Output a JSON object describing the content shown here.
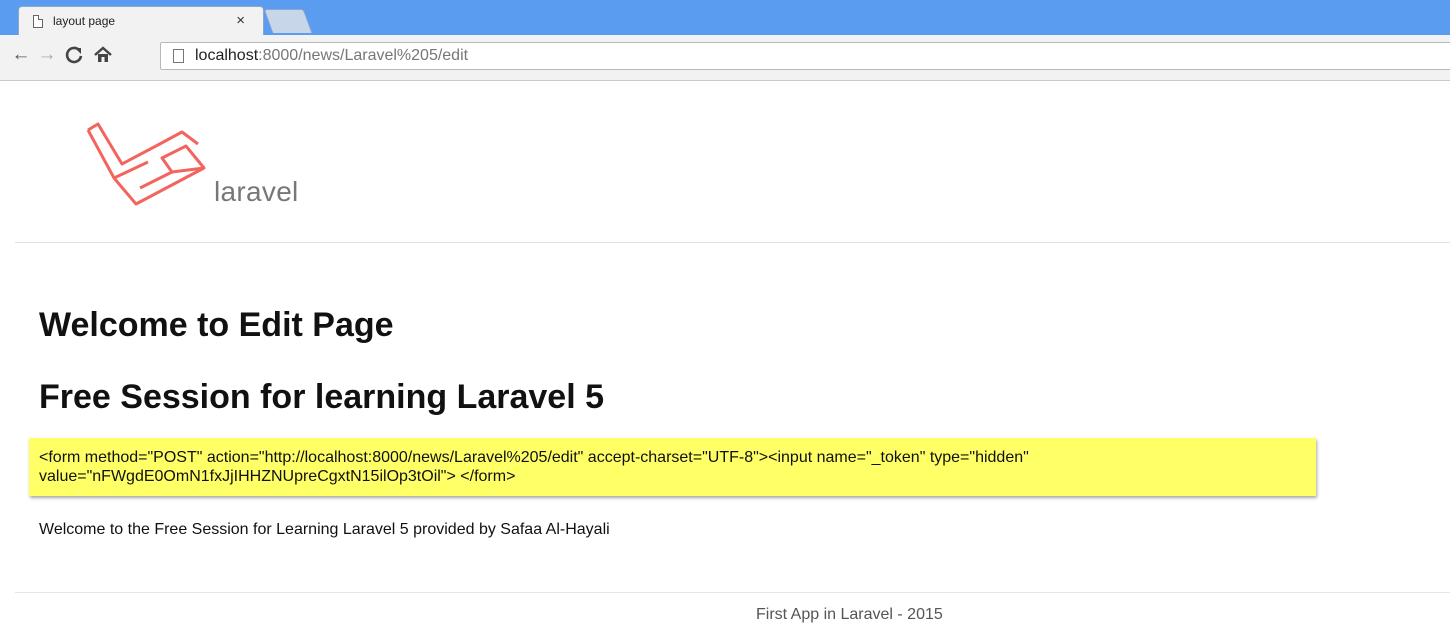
{
  "browser": {
    "tab_title": "layout page",
    "tab_close": "×",
    "url_host": "localhost",
    "url_rest": ":8000/news/Laravel%205/edit",
    "icons": {
      "back": "back-arrow-icon",
      "forward": "forward-arrow-icon",
      "reload": "reload-icon",
      "home": "home-icon",
      "page": "page-icon"
    }
  },
  "page": {
    "logo_text": "laravel",
    "heading_1": "Welcome to Edit Page",
    "heading_2": "Free Session for learning Laravel 5",
    "form_dump_line1": "<form method=\"POST\" action=\"http://localhost:8000/news/Laravel%205/edit\" accept-charset=\"UTF-8\"><input name=\"_token\" type=\"hidden\"",
    "form_dump_line2": "value=\"nFWgdE0OmN1fxJjIHHZNUpreCgxtN15ilOp3tOil\"> </form>",
    "welcome_text": "Welcome to the Free Session for Learning Laravel 5 provided by Safaa Al-Hayali",
    "footer_text": "First App in Laravel - 2015"
  },
  "colors": {
    "tabstrip": "#5a9cf0",
    "logo": "#f4645f",
    "highlight": "#ffff66"
  }
}
